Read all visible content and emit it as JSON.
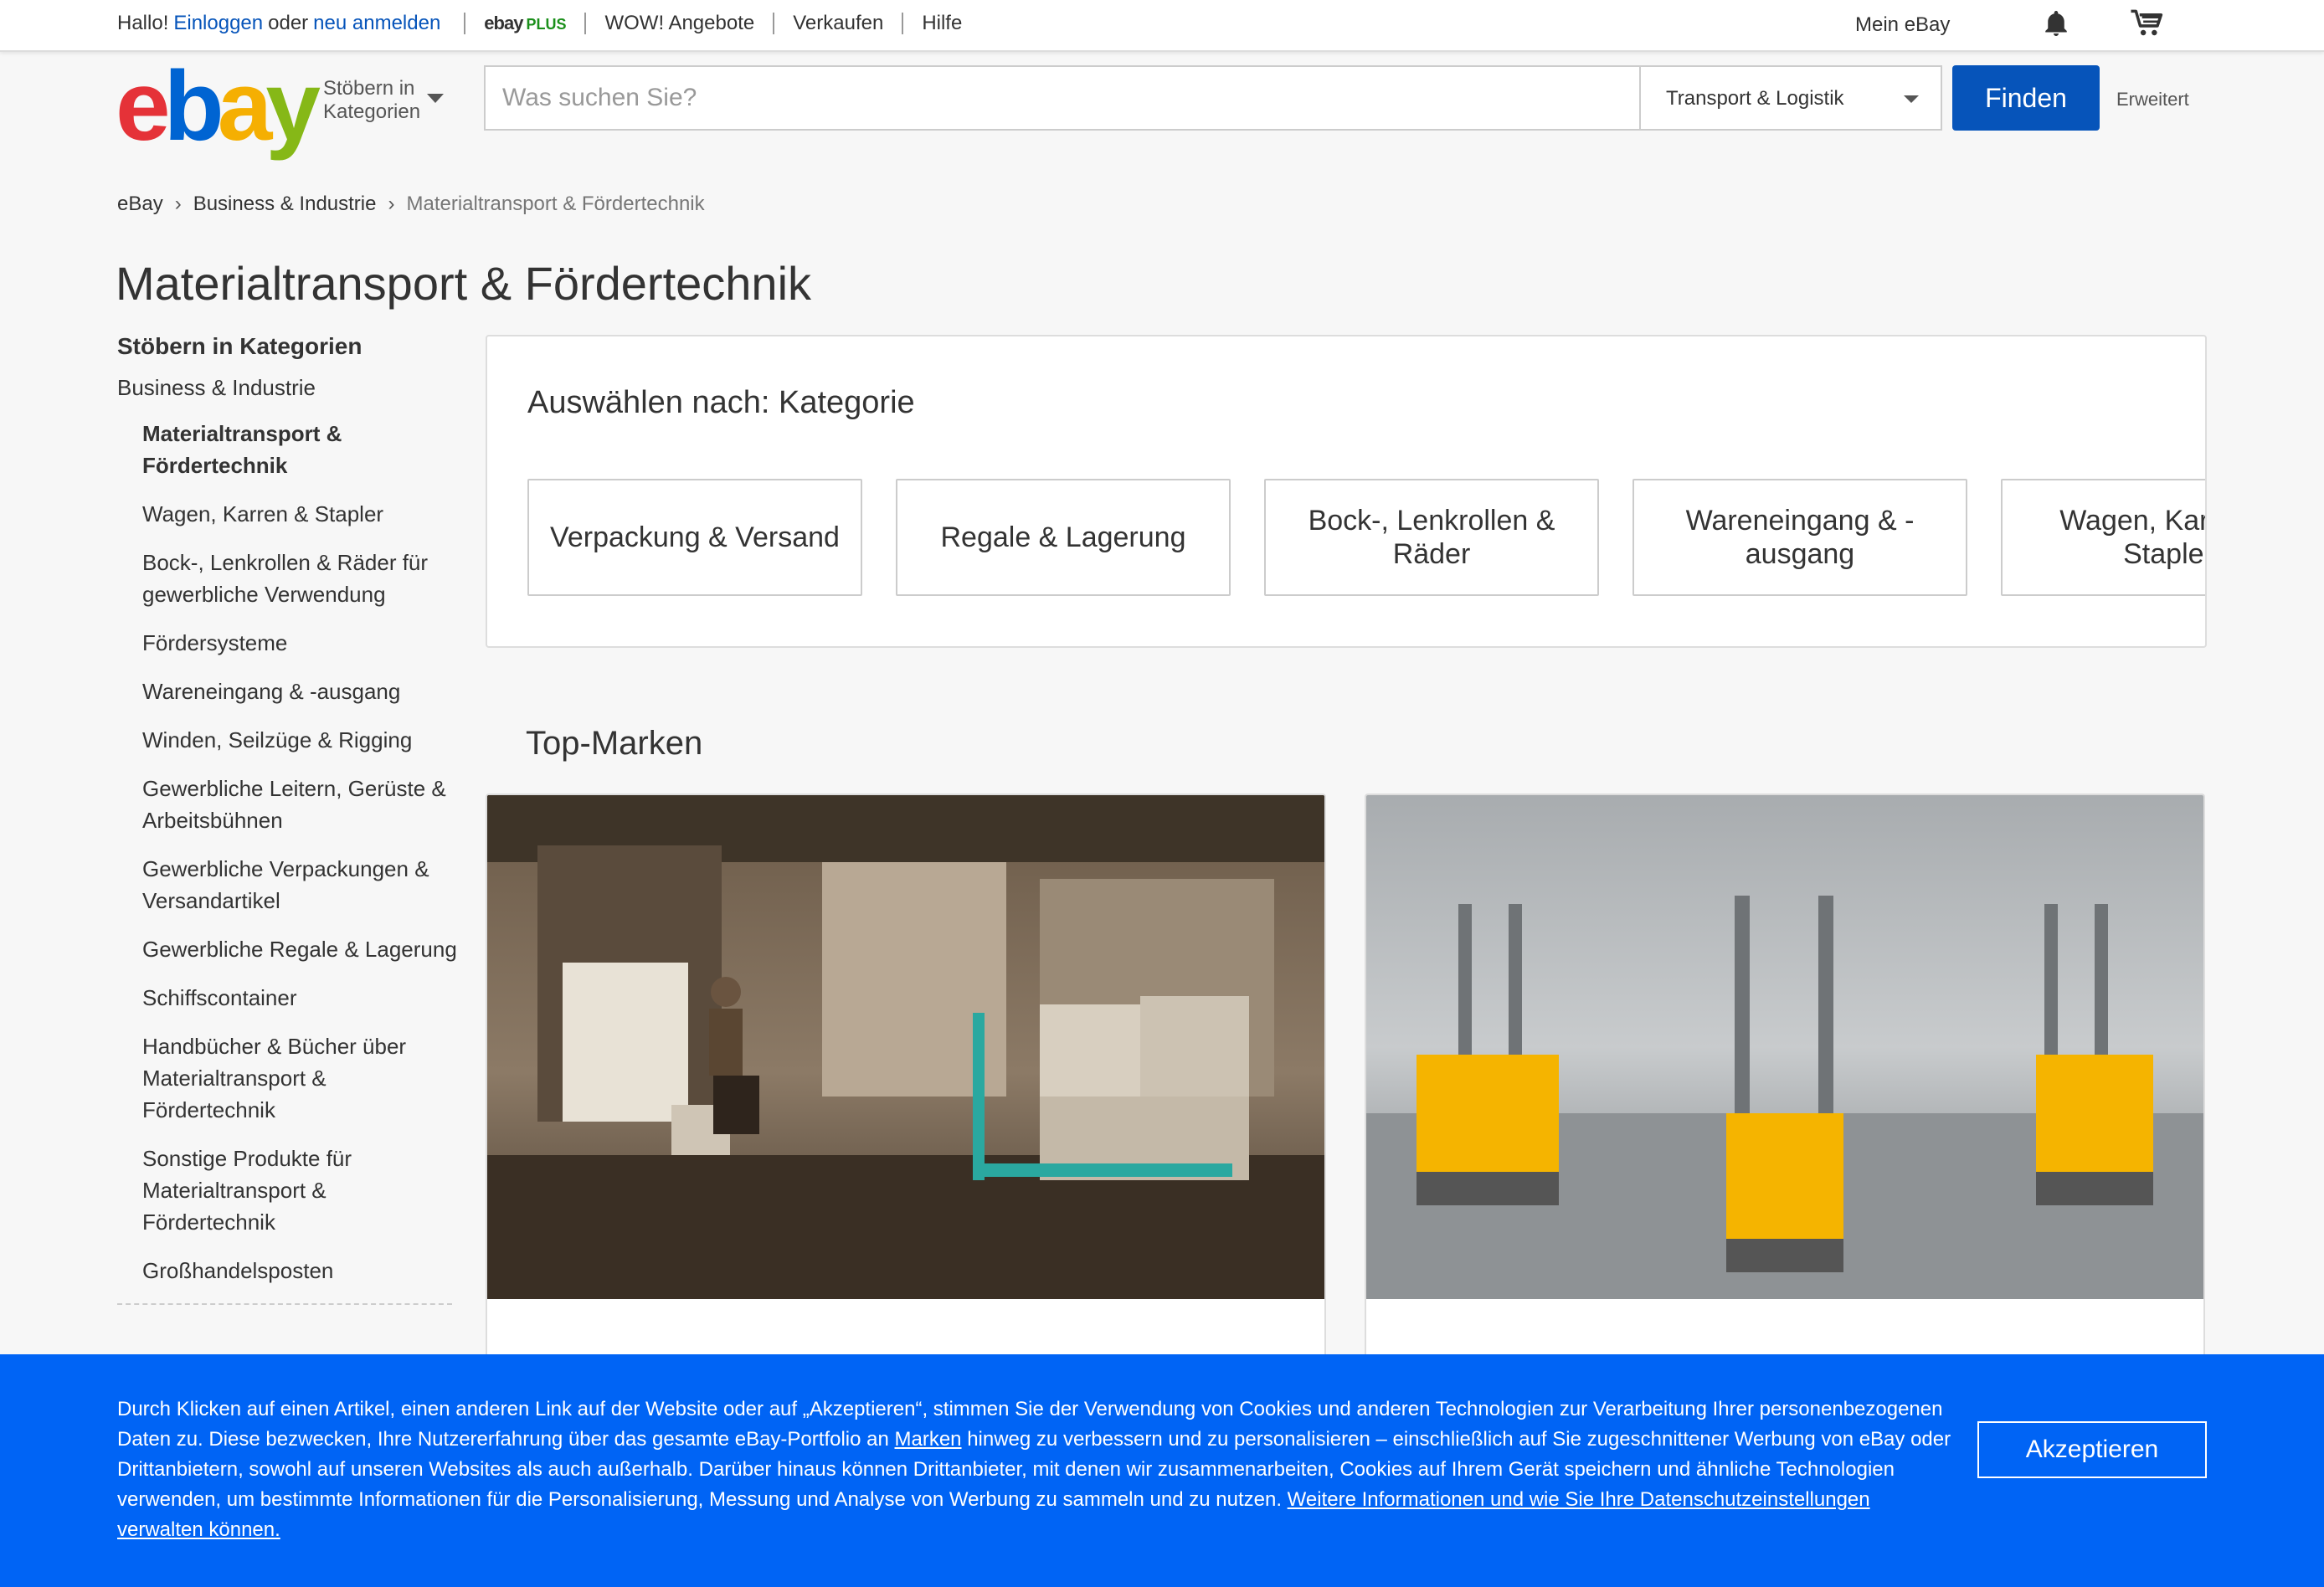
{
  "topbar": {
    "greeting": "Hallo!",
    "signin": "Einloggen",
    "or": "oder",
    "register": "neu anmelden",
    "ebayplus_brand": "ebay",
    "ebayplus_plus": "PLUS",
    "deals": "WOW! Angebote",
    "sell": "Verkaufen",
    "help": "Hilfe",
    "my_ebay": "Mein eBay"
  },
  "header": {
    "logo": {
      "e": "e",
      "b": "b",
      "a": "a",
      "y": "y"
    },
    "browse_categories": "Stöbern in Kategorien",
    "search_placeholder": "Was suchen Sie?",
    "category_selected": "Transport & Logistik",
    "find_button": "Finden",
    "advanced": "Erweitert"
  },
  "breadcrumb": [
    "eBay",
    "Business & Industrie",
    "Materialtransport & Fördertechnik"
  ],
  "page_title": "Materialtransport & Fördertechnik",
  "sidebar": {
    "heading": "Stöbern in Kategorien",
    "parent": "Business & Industrie",
    "items": [
      "Materialtransport & Fördertechnik",
      "Wagen, Karren & Stapler",
      "Bock-, Lenkrollen & Räder für gewerbliche Verwendung",
      "Fördersysteme",
      "Wareneingang & -ausgang",
      "Winden, Seilzüge & Rigging",
      "Gewerbliche Leitern, Gerüste & Arbeitsbühnen",
      "Gewerbliche Verpackungen & Versandartikel",
      "Gewerbliche Regale & Lagerung",
      "Schiffscontainer",
      "Handbücher & Bücher über Materialtransport & Fördertechnik",
      "Sonstige Produkte für Materialtransport & Fördertechnik",
      "Großhandelsposten"
    ]
  },
  "category_box": {
    "heading": "Auswählen nach: Kategorie",
    "tiles": [
      "Verpackung & Versand",
      "Regale & Lagerung",
      "Bock-, Lenkrollen & Räder",
      "Wareneingang & -ausgang",
      "Wagen, Karren & Stapler"
    ]
  },
  "top_brands": {
    "heading": "Top-Marken"
  },
  "cookie": {
    "text_1": "Durch Klicken auf einen Artikel, einen anderen Link auf der Website oder auf „Akzeptieren“, stimmen Sie der Verwendung von Cookies und anderen Technologien zur Verarbeitung Ihrer personenbezogenen Daten zu. Diese bezwecken, Ihre Nutzererfahrung über das gesamte eBay-Portfolio an ",
    "brands_link": "Marken",
    "text_2": " hinweg zu verbessern und zu personalisieren – einschließlich auf Sie zugeschnittener Werbung von eBay oder Drittanbietern, sowohl auf unseren Websites als auch außerhalb. Darüber hinaus können Drittanbieter, mit denen wir zusammenarbeiten, Cookies auf Ihrem Gerät speichern und ähnliche Technologien verwenden, um bestimmte Informationen für die Personalisierung, Messung und Analyse von Werbung zu sammeln und zu nutzen. ",
    "more_link": "Weitere Informationen und wie Sie Ihre Datenschutzeinstellungen verwalten können.",
    "accept": "Akzeptieren"
  },
  "colors": {
    "link": "#0654ba",
    "find_button": "#0654ba",
    "cookie_bg": "#0064f5",
    "logo_e": "#e53238",
    "logo_b": "#0064d2",
    "logo_a": "#f5af02",
    "logo_y": "#86b817"
  }
}
